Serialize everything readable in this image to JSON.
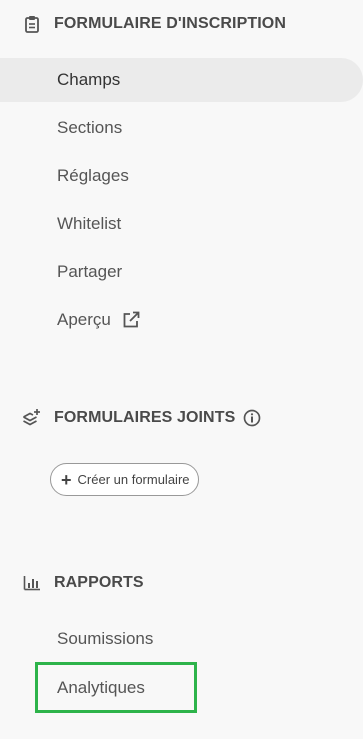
{
  "sections": {
    "registration": {
      "title": "FORMULAIRE D'INSCRIPTION",
      "items": [
        {
          "label": "Champs",
          "active": true
        },
        {
          "label": "Sections"
        },
        {
          "label": "Réglages"
        },
        {
          "label": "Whitelist"
        },
        {
          "label": "Partager"
        },
        {
          "label": "Aperçu"
        }
      ]
    },
    "joined": {
      "title": "FORMULAIRES JOINTS",
      "create_button": "Créer un formulaire"
    },
    "reports": {
      "title": "RAPPORTS",
      "items": [
        {
          "label": "Soumissions"
        },
        {
          "label": "Analytiques"
        }
      ]
    }
  },
  "icons": {
    "registration": "clipboard-icon",
    "joined": "layers-plus-icon",
    "reports": "bar-chart-icon",
    "preview_external": "external-link-icon",
    "info": "info-icon"
  },
  "colors": {
    "highlight": "#2db34a",
    "active_bg": "#ebebeb"
  }
}
